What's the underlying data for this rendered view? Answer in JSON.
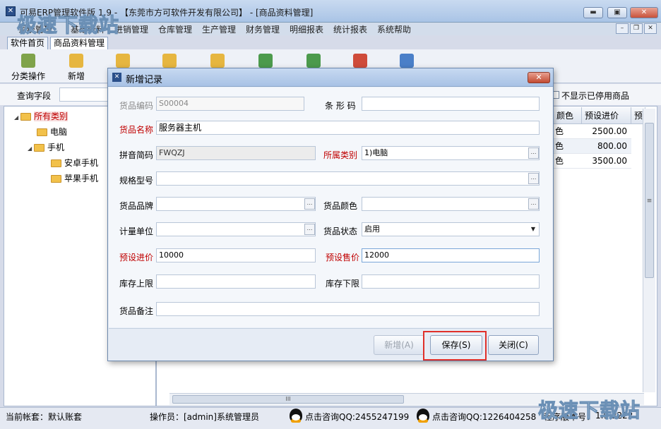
{
  "window": {
    "title": "可易ERP管理软件版 1.9 - 【东莞市方可软件开发有限公司】 - [商品资料管理]",
    "btn_min": "▬",
    "btn_max": "▣",
    "btn_close": "✕"
  },
  "menu": [
    "系统管理",
    "基础资料",
    "进销管理",
    "仓库管理",
    "生产管理",
    "财务管理",
    "明细报表",
    "统计报表",
    "系统帮助"
  ],
  "mdi_buttons": [
    "–",
    "❐",
    "✕"
  ],
  "tabs": [
    "软件首页",
    "商品资料管理"
  ],
  "toolbar": {
    "category_op": "分类操作",
    "add": "新增"
  },
  "search": {
    "label": "查询字段",
    "hide_disabled": "不显示已停用商品"
  },
  "tree": {
    "root": "所有类别",
    "items": [
      "电脑",
      "手机",
      "安卓手机",
      "苹果手机"
    ]
  },
  "grid": {
    "headers": [
      "颜色",
      "预设进价",
      "预"
    ],
    "rows": [
      {
        "color": "色",
        "price": "2500.00"
      },
      {
        "color": "色",
        "price": "800.00"
      },
      {
        "color": "色",
        "price": "3500.00"
      }
    ],
    "hscroll_grip": "III",
    "vscroll_grip": "≡"
  },
  "status": {
    "account": "当前帐套：默认账套",
    "operator": "操作员：[admin]系统管理员",
    "qq1": "点击咨询QQ:2455247199",
    "qq2": "点击咨询QQ:1226404258",
    "version_label": "程序版本号：",
    "version": "1.9.3222"
  },
  "watermarks": [
    "极速下载站",
    "极速下载站"
  ],
  "dialog": {
    "title": "新增记录",
    "close": "✕",
    "fields": {
      "code_label": "货品编码",
      "code_value": "S00004",
      "barcode_label": "条 形 码",
      "barcode_value": "",
      "name_label": "货品名称",
      "name_value": "服务器主机",
      "pinyin_label": "拼音简码",
      "pinyin_value": "FWQZJ",
      "category_label": "所属类别",
      "category_value": "1)电脑",
      "spec_label": "规格型号",
      "spec_value": "",
      "brand_label": "货品品牌",
      "brand_value": "",
      "color_label": "货品颜色",
      "color_value": "",
      "unit_label": "计量单位",
      "unit_value": "",
      "status_label": "货品状态",
      "status_value": "启用",
      "cost_label": "预设进价",
      "cost_value": "10000",
      "sale_label": "预设售价",
      "sale_value": "12000",
      "stock_max_label": "库存上限",
      "stock_max_value": "",
      "stock_min_label": "库存下限",
      "stock_min_value": "",
      "note_label": "货品备注",
      "note_value": ""
    },
    "buttons": {
      "add": "新增(A)",
      "save": "保存(S)",
      "close": "关闭(C)"
    },
    "dots": "…",
    "dropdown_arrow": "▼"
  },
  "colors": {
    "required_label": "#c00000",
    "highlight": "#e0302a"
  }
}
